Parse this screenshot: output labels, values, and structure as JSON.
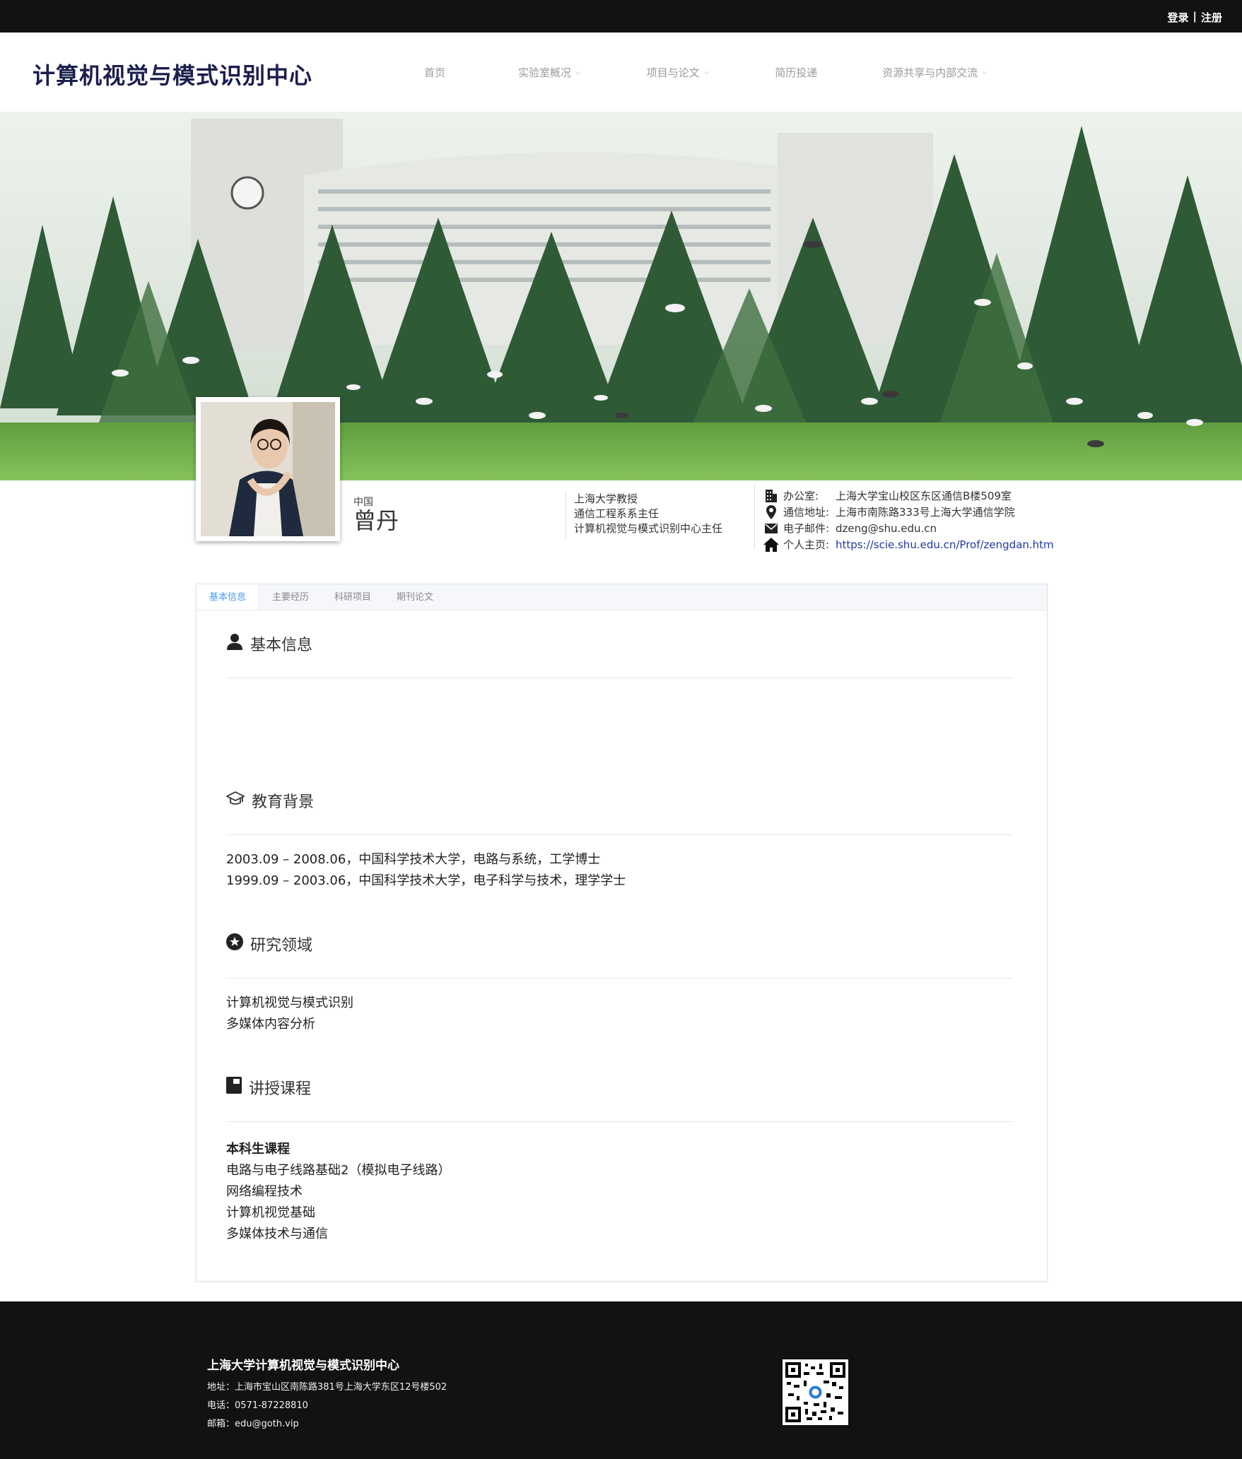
{
  "topbar": {
    "login": "登录",
    "sep": "|",
    "register": "注册"
  },
  "header": {
    "site_title": "计算机视觉与模式识别中心",
    "nav": [
      {
        "label": "首页",
        "dropdown": false
      },
      {
        "label": "实验室概况",
        "dropdown": true
      },
      {
        "label": "项目与论文",
        "dropdown": true
      },
      {
        "label": "简历投递",
        "dropdown": false
      },
      {
        "label": "资源共享与内部交流",
        "dropdown": true
      }
    ]
  },
  "profile": {
    "country": "中国",
    "name": "曾丹",
    "titles": [
      "上海大学教授",
      "通信工程系系主任",
      "计算机视觉与模式识别中心主任"
    ],
    "contacts": [
      {
        "icon": "building-icon",
        "label": "办公室:",
        "value": "上海大学宝山校区东区通信B楼509室"
      },
      {
        "icon": "location-pin-icon",
        "label": "通信地址:",
        "value": "上海市南陈路333号上海大学通信学院"
      },
      {
        "icon": "envelope-icon",
        "label": "电子邮件:",
        "value": "dzeng@shu.edu.cn"
      },
      {
        "icon": "home-icon",
        "label": "个人主页:",
        "value": "https://scie.shu.edu.cn/Prof/zengdan.htm"
      }
    ]
  },
  "tabs": [
    "基本信息",
    "主要经历",
    "科研项目",
    "期刊论文"
  ],
  "sections": {
    "basic": {
      "title": "基本信息",
      "icon": "user-icon"
    },
    "education": {
      "title": "教育背景",
      "icon": "graduation-cap-icon",
      "lines": [
        "2003.09 – 2008.06，中国科学技术大学，电路与系统，工学博士",
        "1999.09 – 2003.06，中国科学技术大学，电子科学与技术，理学学士"
      ]
    },
    "research": {
      "title": "研究领域",
      "icon": "star-circle-icon",
      "lines": [
        "计算机视觉与模式识别",
        "多媒体内容分析"
      ]
    },
    "courses": {
      "title": "讲授课程",
      "icon": "book-icon",
      "subtitle": "本科生课程",
      "lines": [
        "电路与电子线路基础2（模拟电子线路）",
        "网络编程技术",
        "计算机视觉基础",
        "多媒体技术与通信"
      ]
    }
  },
  "footer": {
    "title": "上海大学计算机视觉与模式识别中心",
    "address": "地址：上海市宝山区南陈路381号上海大学东区12号楼502",
    "phone": "电话：0571-87228810",
    "email": "邮箱：edu@goth.vip"
  },
  "colors": {
    "topbar": "#111214",
    "title": "#1a1f4d",
    "link": "#1f3b9e",
    "tab_active": "#409eff"
  }
}
